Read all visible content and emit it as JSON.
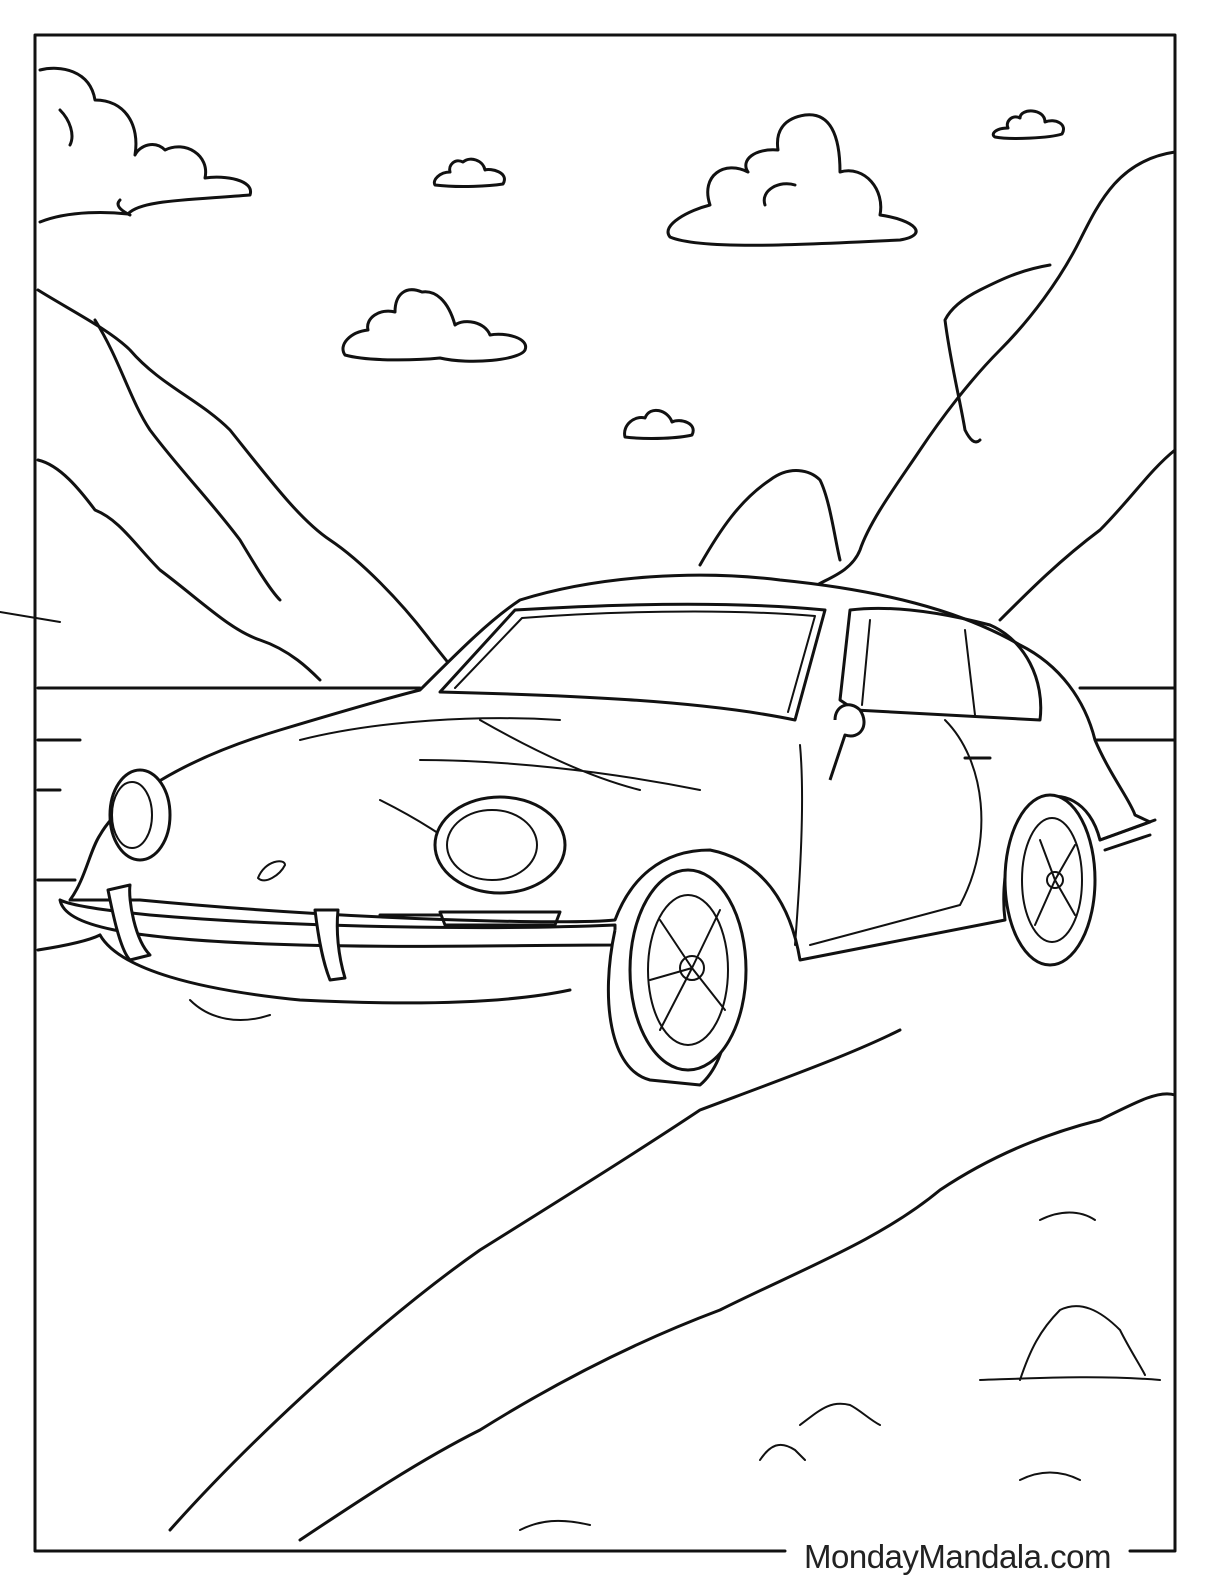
{
  "page": {
    "subject": "Porsche 911 coloring page",
    "footer_credit": "MondayMandala.com"
  },
  "colors": {
    "line": "#111111",
    "background": "#ffffff"
  }
}
